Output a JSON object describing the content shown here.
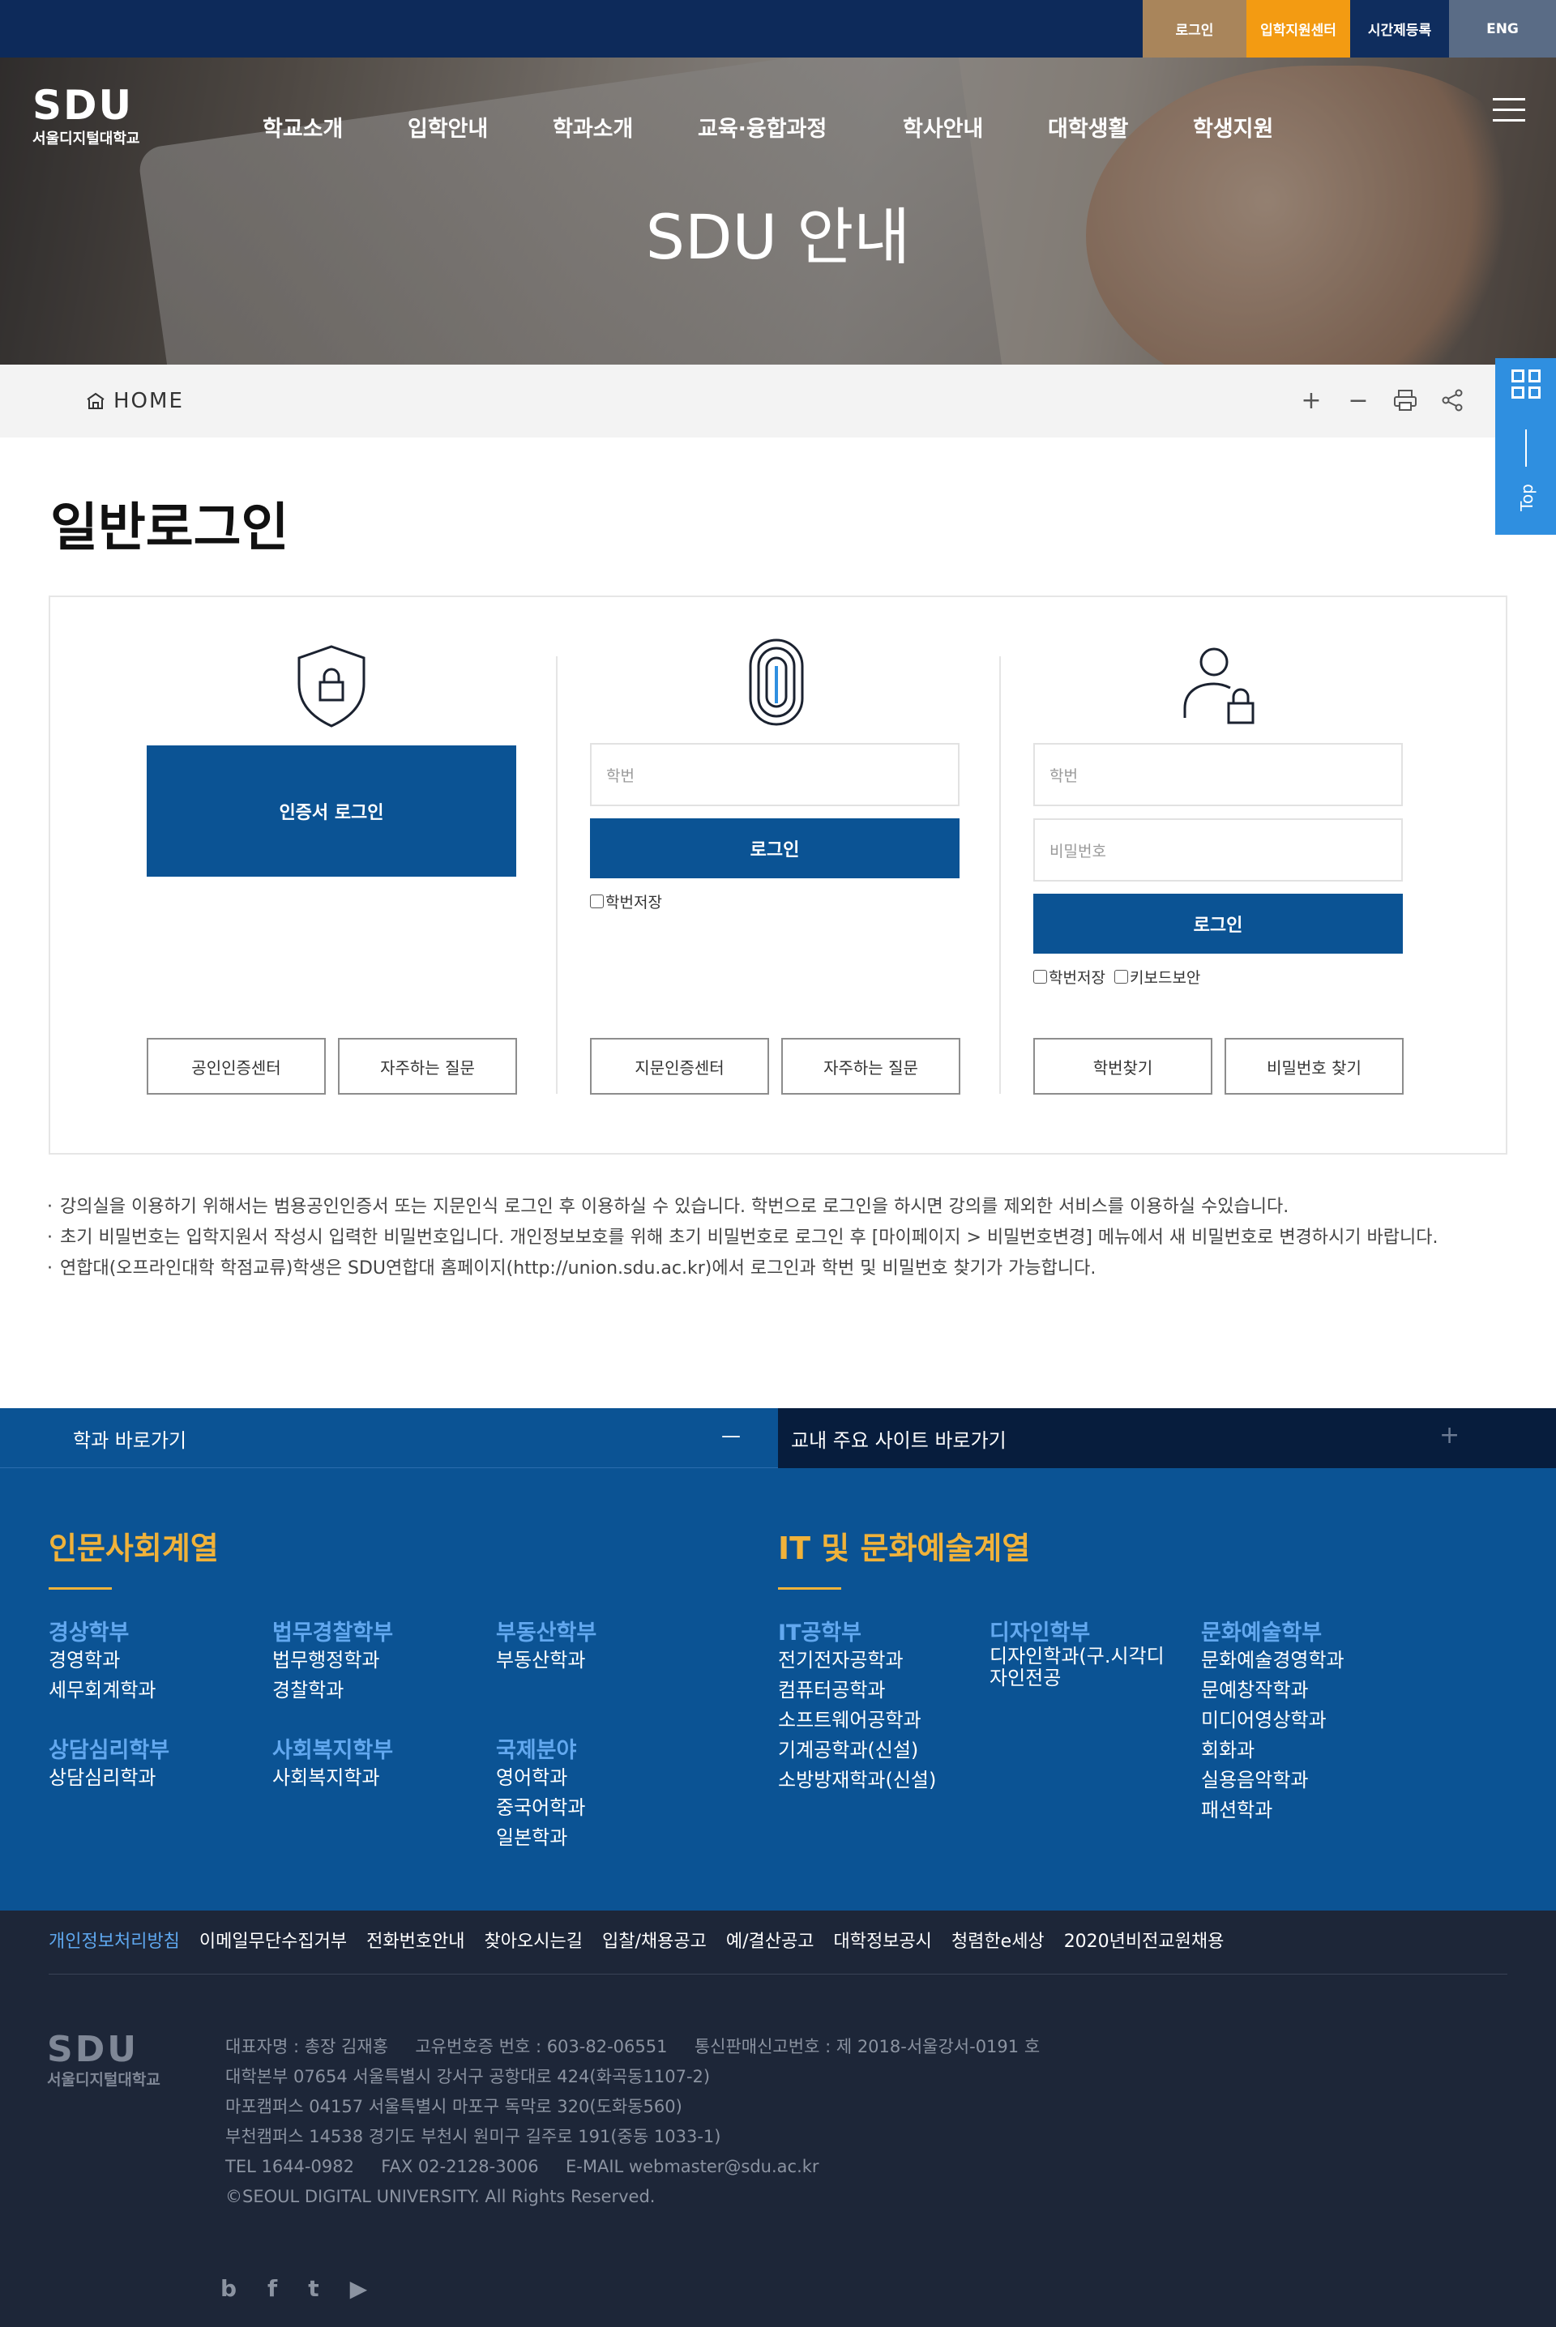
{
  "topbar": {
    "login": "로그인",
    "admission_center": "입학지원센터",
    "timetable": "시간제등록",
    "eng": "ENG"
  },
  "header": {
    "logo_en": "SDU",
    "logo_kr": "서울디지털대학교",
    "nav": [
      "학교소개",
      "입학안내",
      "학과소개",
      "교육·융합과정",
      "학사안내",
      "대학생활",
      "학생지원"
    ],
    "hero_title": "SDU 안내"
  },
  "breadcrumb": {
    "home": "HOME"
  },
  "quick": {
    "top": "Top"
  },
  "page_title": "일반로그인",
  "login": {
    "cert": {
      "button": "인증서 로그인",
      "link1": "공인인증센터",
      "link2": "자주하는 질문"
    },
    "finger": {
      "id_placeholder": "학번",
      "button": "로그인",
      "save_id": "학번저장",
      "link1": "지문인증센터",
      "link2": "자주하는 질문"
    },
    "general": {
      "id_placeholder": "학번",
      "pw_placeholder": "비밀번호",
      "button": "로그인",
      "save_id": "학번저장",
      "keyboard": "키보드보안",
      "link1": "학번찾기",
      "link2": "비밀번호 찾기"
    }
  },
  "notes": [
    "강의실을 이용하기 위해서는 범용공인인증서 또는 지문인식 로그인 후 이용하실 수 있습니다. 학번으로 로그인을 하시면 강의를 제외한 서비스를 이용하실 수있습니다.",
    "초기 비밀번호는 입학지원서 작성시 입력한 비밀번호입니다. 개인정보보호를 위해 초기 비밀번호로 로그인 후 [마이페이지 > 비밀번호변경] 메뉴에서 새 비밀번호로 변경하시기 바랍니다.",
    "연합대(오프라인대학 학점교류)학생은 SDU연합대 홈페이지(http://union.sdu.ac.kr)에서 로그인과 학번 및 비밀번호 찾기가 가능합니다."
  ],
  "footer_tabs": {
    "left": "학과 바로가기",
    "left_icon": "—",
    "right": "교내 주요 사이트 바로가기",
    "right_icon": "+"
  },
  "departments": {
    "group1": "인문사회계열",
    "group2": "IT 및 문화예술계열",
    "schools": [
      {
        "name": "경상학부",
        "majors": [
          "경영학과",
          "세무회계학과"
        ]
      },
      {
        "name": "법무경찰학부",
        "majors": [
          "법무행정학과",
          "경찰학과"
        ]
      },
      {
        "name": "부동산학부",
        "majors": [
          "부동산학과"
        ]
      },
      {
        "name": "상담심리학부",
        "majors": [
          "상담심리학과"
        ]
      },
      {
        "name": "사회복지학부",
        "majors": [
          "사회복지학과"
        ]
      },
      {
        "name": "국제분야",
        "majors": [
          "영어학과",
          "중국어학과",
          "일본학과"
        ]
      },
      {
        "name": "IT공학부",
        "majors": [
          "전기전자공학과",
          "컴퓨터공학과",
          "소프트웨어공학과",
          "기계공학과(신설)",
          "소방방재학과(신설)"
        ]
      },
      {
        "name": "디자인학부",
        "majors": [
          "디자인학과(구.시각디자인전공"
        ]
      },
      {
        "name": "문화예술학부",
        "majors": [
          "문화예술경영학과",
          "문예창작학과",
          "미디어영상학과",
          "회화과",
          "실용음악학과",
          "패션학과"
        ]
      }
    ]
  },
  "footer": {
    "links": [
      "개인정보처리방침",
      "이메일무단수집거부",
      "전화번호안내",
      "찾아오시는길",
      "입찰/채용공고",
      "예/결산공고",
      "대학정보공시",
      "청렴한e세상",
      "2020년비전교원채용"
    ],
    "logo_en": "SDU",
    "logo_kr": "서울디지털대학교",
    "info": [
      "대표자명 : 총장 김재홍     고유번호증 번호 : 603-82-06551     통신판매신고번호 : 제 2018-서울강서-0191 호",
      "대학본부 07654 서울특별시 강서구 공항대로 424(화곡동1107-2)",
      "마포캠퍼스 04157 서울특별시 마포구 독막로 320(도화동560)",
      "부천캠퍼스 14538 경기도 부천시 원미구 길주로 191(중동 1033-1)",
      "TEL 1644-0982     FAX 02-2128-3006     E-MAIL webmaster@sdu.ac.kr",
      "©SEOUL DIGITAL UNIVERSITY. All Rights Reserved."
    ],
    "sns": [
      "b",
      "f",
      "t",
      "▶"
    ]
  },
  "colors": {
    "navy": "#0d2a5a",
    "blue": "#0b5394",
    "gold": "#a9855b",
    "orange": "#f39b12",
    "accent_yellow": "#f0b23a",
    "sub_blue": "#62a8ef",
    "quick": "#2f8fe0"
  }
}
